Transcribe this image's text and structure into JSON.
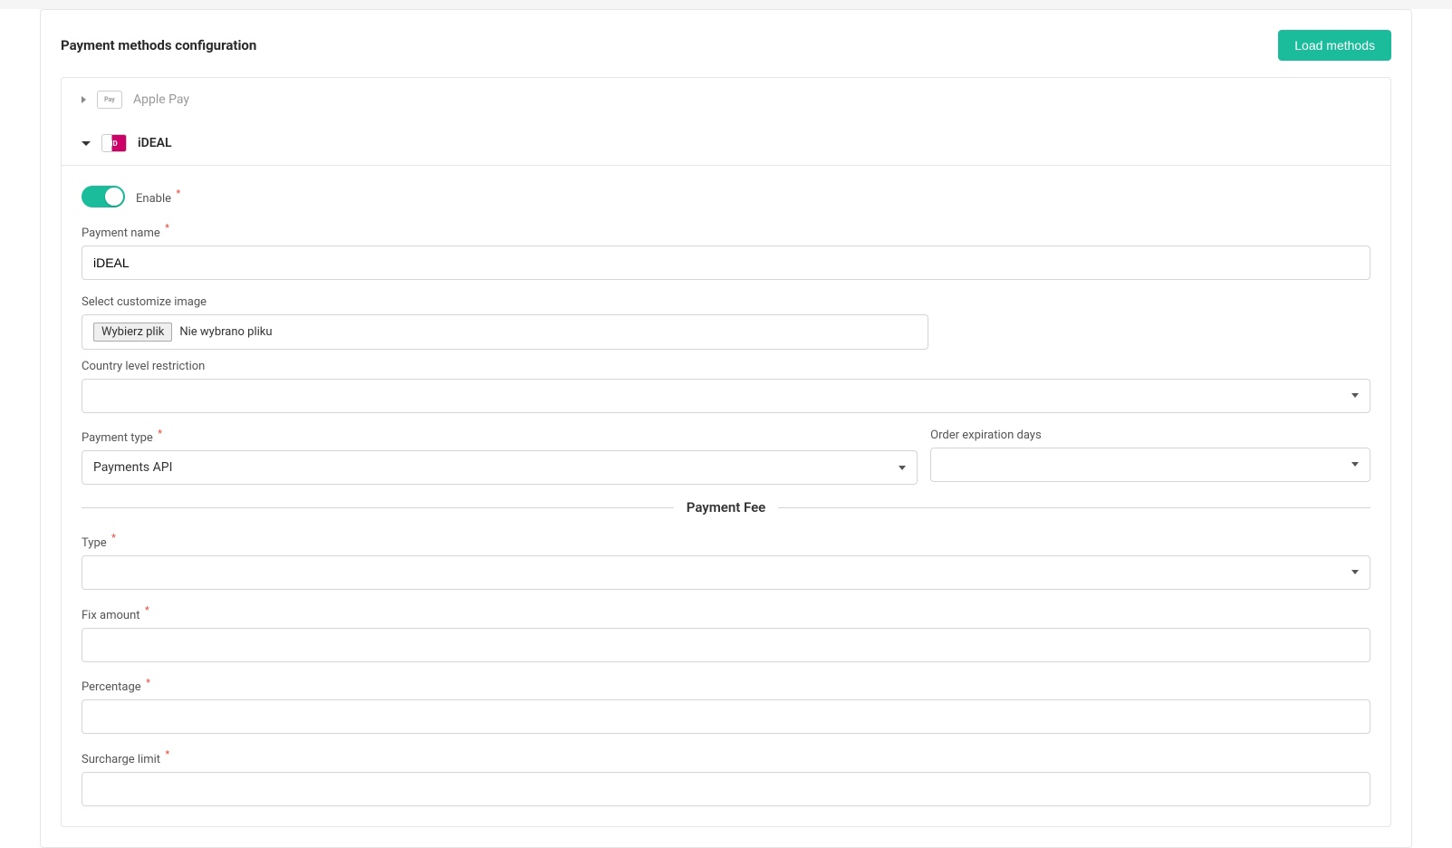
{
  "header": {
    "title": "Payment methods configuration",
    "load_button": "Load methods"
  },
  "methods": {
    "applepay": {
      "label": "Apple Pay",
      "logo_text": "Pay"
    },
    "ideal": {
      "label": "iDEAL",
      "logo_text": "iD"
    }
  },
  "form": {
    "enable_label": "Enable",
    "payment_name_label": "Payment name",
    "payment_name_value": "iDEAL",
    "customize_image_label": "Select customize image",
    "file_button": "Wybierz plik",
    "file_none": "Nie wybrano pliku",
    "country_restriction_label": "Country level restriction",
    "country_restriction_value": "",
    "payment_type_label": "Payment type",
    "payment_type_value": "Payments API",
    "order_expiration_label": "Order expiration days",
    "order_expiration_value": "",
    "fee_legend": "Payment Fee",
    "type_label": "Type",
    "type_value": "",
    "fix_amount_label": "Fix amount",
    "fix_amount_value": "",
    "percentage_label": "Percentage",
    "percentage_value": "",
    "surcharge_limit_label": "Surcharge limit",
    "surcharge_limit_value": ""
  }
}
